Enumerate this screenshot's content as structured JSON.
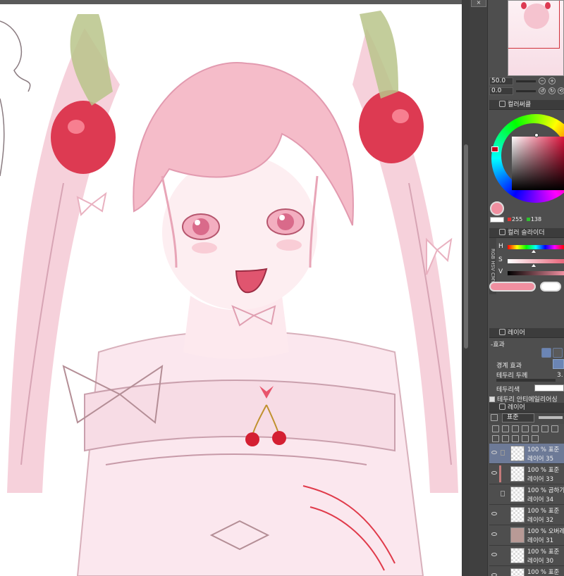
{
  "app": {
    "close_glyph": "×"
  },
  "navigator": {
    "zoom_value": "50.0",
    "rotate_value": "0.0"
  },
  "color_wheel_panel": {
    "tab_label": "컬러써클",
    "rgb_r": "255",
    "rgb_g": "138",
    "main_color": "#f08fa0",
    "sub_color": "#ffffff"
  },
  "color_slider_panel": {
    "tab_label": "컬러 슬라이더",
    "side_label": "RGB HSV CMY",
    "h_label": "H",
    "s_label": "S",
    "v_label": "V"
  },
  "layer_property_panel": {
    "tab_label": "레이어",
    "effect_label": "-효과",
    "border_effect_label": "경계 효과",
    "border_thickness_label": "테두리 두께",
    "border_thickness_value": "3.",
    "border_color_label": "테두리색",
    "antialias_label": "테두리 안티에일리어싱"
  },
  "layer_panel": {
    "tab_label": "레이어",
    "blend_mode": "표준",
    "layers": [
      {
        "meta": "100 % 표준",
        "name": "레이어 35",
        "active": true,
        "thumb": "transparent"
      },
      {
        "meta": "100 % 표준",
        "name": "레이어 33",
        "active": false,
        "thumb": "transparent"
      },
      {
        "meta": "100 % 곱하기",
        "name": "레이어 34",
        "active": false,
        "thumb": "transparent"
      },
      {
        "meta": "100 % 표준",
        "name": "레이어 32",
        "active": false,
        "thumb": "transparent"
      },
      {
        "meta": "100 % 오버레이",
        "name": "레이어 31",
        "active": false,
        "thumb": "solid"
      },
      {
        "meta": "100 % 표준",
        "name": "레이어 30",
        "active": false,
        "thumb": "transparent"
      },
      {
        "meta": "100 % 표준",
        "name": "",
        "active": false,
        "thumb": "transparent"
      }
    ]
  }
}
